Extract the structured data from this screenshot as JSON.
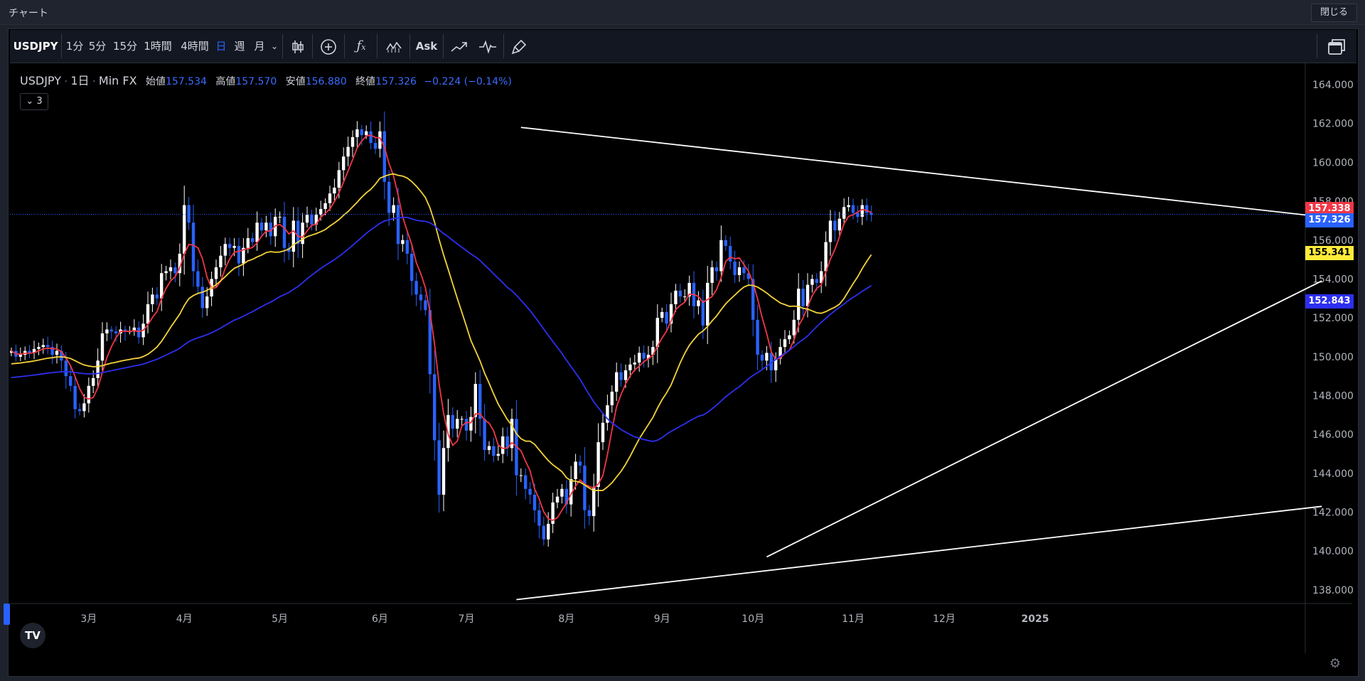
{
  "window": {
    "title": "チャート",
    "close_label": "閉じる"
  },
  "toolbar": {
    "symbol": "USDJPY",
    "intervals": [
      "1分",
      "5分",
      "15分",
      "1時間",
      "4時間",
      "日",
      "週",
      "月"
    ],
    "active_interval": "日",
    "more_icon": "chevron-down-icon",
    "tools": [
      {
        "name": "candles-icon"
      },
      {
        "name": "compare-plus-icon"
      },
      {
        "name": "indicators-fx-icon"
      },
      {
        "name": "templates-icon"
      },
      {
        "name": "ask-label",
        "label": "Ask"
      },
      {
        "name": "trend-icon"
      },
      {
        "name": "replay-icon"
      },
      {
        "name": "brush-icon"
      }
    ],
    "layout_icon": "layout-windows-icon"
  },
  "legend": {
    "symbol": "USDJPY",
    "interval": "1日",
    "source": "Min FX",
    "open_label": "始値",
    "open": "157.534",
    "high_label": "高値",
    "high": "157.570",
    "low_label": "安値",
    "low": "156.880",
    "close_label": "終値",
    "close": "157.326",
    "change": "−0.224 (−0.14%)",
    "indicator_toggle": "3"
  },
  "price_labels": [
    {
      "value": "157.338",
      "color": "#f23645"
    },
    {
      "value": "157.326",
      "color": "#2962ff"
    },
    {
      "value": "155.341",
      "color": "#ffeb3b"
    },
    {
      "value": "152.843",
      "color": "#1f2fe0"
    }
  ],
  "colors": {
    "up": "#ffffff",
    "down": "#2962ff",
    "ma_fast": "#f23645",
    "ma_mid": "#f5d33b",
    "ma_slow": "#2d2ff0",
    "trendline": "#ffffff"
  },
  "chart_data": {
    "type": "candlestick",
    "symbol": "USDJPY",
    "y_ticks": [
      164,
      162,
      160,
      158,
      156,
      154,
      152,
      150,
      148,
      146,
      144,
      142,
      140,
      138
    ],
    "y_tick_labels": [
      "164.000",
      "162.000",
      "160.000",
      "158.000",
      "156.000",
      "154.000",
      "152.000",
      "150.000",
      "148.000",
      "146.000",
      "144.000",
      "142.000",
      "140.000",
      "138.000"
    ],
    "ylim": [
      137.3,
      165.1
    ],
    "x_ticks": [
      {
        "label": "3月",
        "index": 17
      },
      {
        "label": "4月",
        "index": 38
      },
      {
        "label": "5月",
        "index": 59
      },
      {
        "label": "6月",
        "index": 81
      },
      {
        "label": "7月",
        "index": 100
      },
      {
        "label": "8月",
        "index": 122
      },
      {
        "label": "9月",
        "index": 143
      },
      {
        "label": "10月",
        "index": 163
      },
      {
        "label": "11月",
        "index": 185
      },
      {
        "label": "12月",
        "index": 205
      },
      {
        "label": "2025",
        "index": 225
      }
    ],
    "closes": [
      150.3,
      150.0,
      150.1,
      150.3,
      150.2,
      150.4,
      150.5,
      150.6,
      150.5,
      150.1,
      150.3,
      149.8,
      149.0,
      148.5,
      147.3,
      147.2,
      147.6,
      148.5,
      148.9,
      149.8,
      151.2,
      151.4,
      151.3,
      151.2,
      151.4,
      151.3,
      151.3,
      151.5,
      151.0,
      151.7,
      152.7,
      153.2,
      153.0,
      154.3,
      154.4,
      154.6,
      154.3,
      155.3,
      157.8,
      156.9,
      154.4,
      153.6,
      152.5,
      153.1,
      154.0,
      154.6,
      155.2,
      155.8,
      155.6,
      155.7,
      154.8,
      155.6,
      156.1,
      155.9,
      156.9,
      156.5,
      156.9,
      156.2,
      157.2,
      157.2,
      155.6,
      155.4,
      157.0,
      155.8,
      156.9,
      157.3,
      156.8,
      157.3,
      157.6,
      157.9,
      158.4,
      158.7,
      159.6,
      160.3,
      160.8,
      161.3,
      161.7,
      161.4,
      161.6,
      161.0,
      160.7,
      161.6,
      159.0,
      157.4,
      157.8,
      155.8,
      156.0,
      155.3,
      153.9,
      153.2,
      152.9,
      152.4,
      149.1,
      145.7,
      142.9,
      145.3,
      147.0,
      146.3,
      146.8,
      146.8,
      146.2,
      146.9,
      148.6,
      146.8,
      145.2,
      145.4,
      144.9,
      145.0,
      145.9,
      145.3,
      146.8,
      143.9,
      143.9,
      143.2,
      142.9,
      142.1,
      141.3,
      140.6,
      141.4,
      142.5,
      142.8,
      143.2,
      142.4,
      143.7,
      144.6,
      144.4,
      142.1,
      141.8,
      143.3,
      145.6,
      146.6,
      147.5,
      148.2,
      149.2,
      148.8,
      149.3,
      149.6,
      149.7,
      150.2,
      149.9,
      150.1,
      150.5,
      152.0,
      152.3,
      151.7,
      152.7,
      153.4,
      153.1,
      153.1,
      153.8,
      152.6,
      152.9,
      151.6,
      153.8,
      154.6,
      154.4,
      156.0,
      155.7,
      154.9,
      154.2,
      154.6,
      154.3,
      154.0,
      151.9,
      150.1,
      149.8,
      150.2,
      149.3,
      149.9,
      150.5,
      150.9,
      151.1,
      151.9,
      153.5,
      152.6,
      153.7,
      154.0,
      153.8,
      154.4,
      155.9,
      157.0,
      156.5,
      157.1,
      157.7,
      157.8,
      157.4,
      157.2,
      157.8,
      157.4,
      157.3
    ],
    "trendlines": [
      {
        "from": [
          112,
          161.8
        ],
        "to": [
          288,
          157.2
        ]
      },
      {
        "from": [
          166,
          139.7
        ],
        "to": [
          288,
          153.9
        ]
      },
      {
        "from": [
          111,
          137.5
        ],
        "to": [
          288,
          142.3
        ]
      }
    ],
    "indicators": [
      {
        "type": "SMA",
        "period": 5,
        "color": "#f23645"
      },
      {
        "type": "SMA",
        "period": 20,
        "color": "#f5d33b"
      },
      {
        "type": "SMA",
        "period": 50,
        "color": "#2d2ff0"
      }
    ]
  }
}
